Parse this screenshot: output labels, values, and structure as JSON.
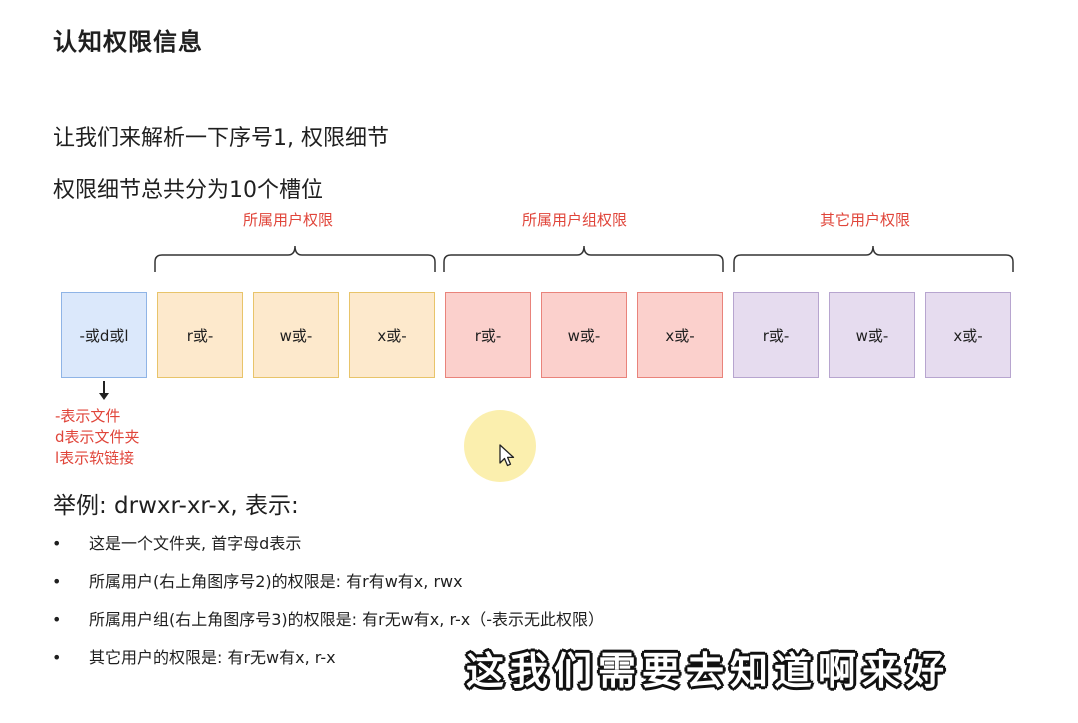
{
  "slide": {
    "title": "认知权限信息",
    "intro_line1": "让我们来解析一下序号1, 权限细节",
    "intro_line2": "权限细节总共分为10个槽位"
  },
  "groups": {
    "owner": "所属用户权限",
    "group": "所属用户组权限",
    "other": "其它用户权限"
  },
  "slots": {
    "type": "-或d或l",
    "owner_r": "r或-",
    "owner_w": "w或-",
    "owner_x": "x或-",
    "group_r": "r或-",
    "group_w": "w或-",
    "group_x": "x或-",
    "other_r": "r或-",
    "other_w": "w或-",
    "other_x": "x或-"
  },
  "type_note": {
    "line1": "-表示文件",
    "line2": "d表示文件夹",
    "line3": "l表示软链接"
  },
  "example": {
    "heading": "举例: drwxr-xr-x, 表示:",
    "bullets": [
      "这是一个文件夹, 首字母d表示",
      "所属用户(右上角图序号2)的权限是: 有r有w有x, rwx",
      "所属用户组(右上角图序号3)的权限是: 有r无w有x, r-x（-表示无此权限）",
      "其它用户的权限是: 有r无w有x, r-x"
    ]
  },
  "subtitle": "这我们需要去知道啊来好",
  "colors": {
    "accent_red": "#e0453a",
    "type_slot": "#dbe8fb",
    "owner_slot": "#fde9cc",
    "group_slot": "#fbd0cc",
    "other_slot": "#e6dcef"
  }
}
